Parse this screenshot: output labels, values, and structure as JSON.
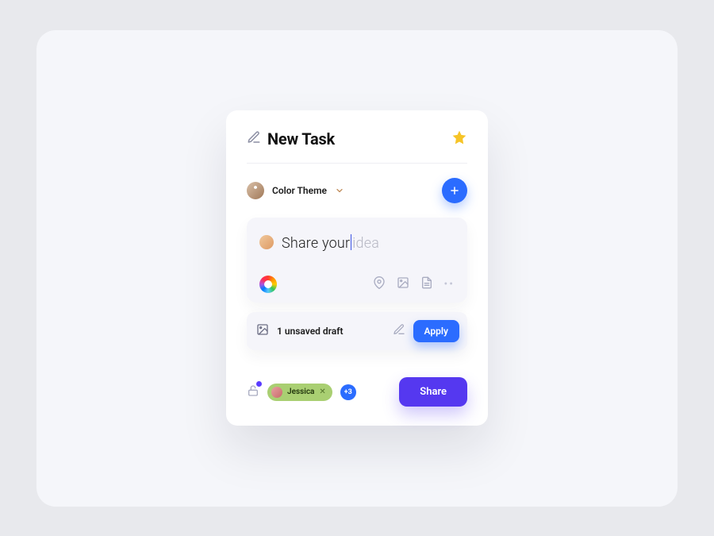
{
  "header": {
    "title": "New Task"
  },
  "theme": {
    "label": "Color Theme"
  },
  "composer": {
    "typed_text": "Share your",
    "placeholder_tail": "idea"
  },
  "draft": {
    "label": "1 unsaved draft",
    "apply_label": "Apply"
  },
  "footer": {
    "chip_name": "Jessica",
    "more_count": "+3",
    "share_label": "Share"
  },
  "colors": {
    "primary_blue": "#2b6cff",
    "accent_purple": "#5538f0",
    "star_yellow": "#f6c427",
    "chip_green": "#a9cf72"
  }
}
